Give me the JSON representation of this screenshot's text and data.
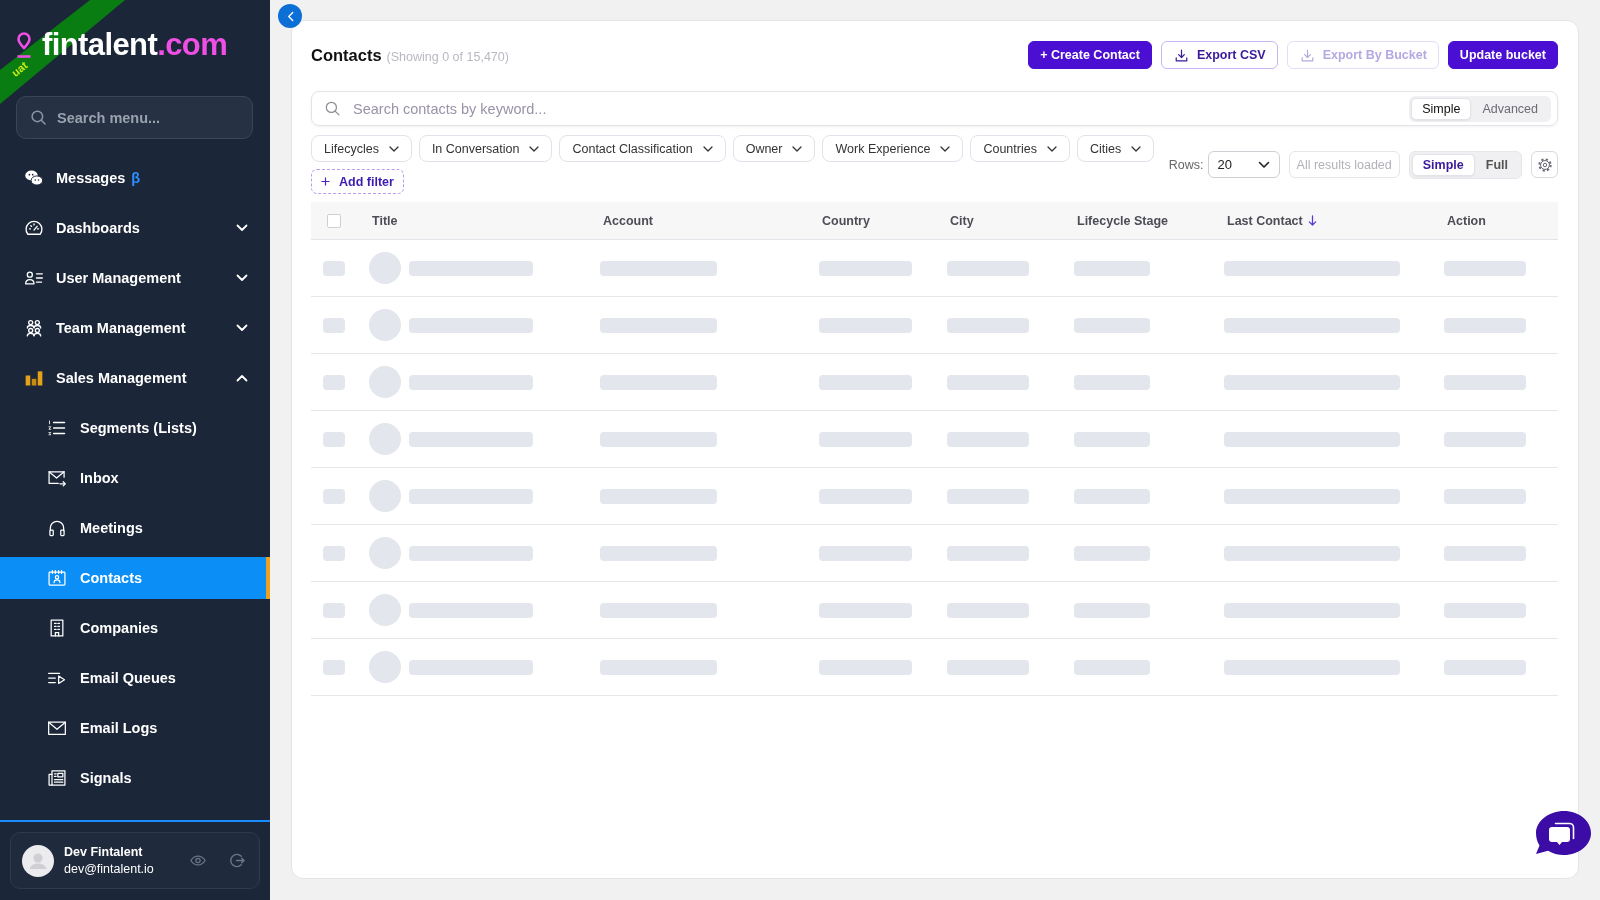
{
  "environment_ribbon": {
    "label": "uat"
  },
  "sidebar": {
    "logo": {
      "name": "fintalent",
      "domain": ".com"
    },
    "search": {
      "placeholder": "Search menu..."
    },
    "items": [
      {
        "label": "Messages",
        "badge": "β",
        "kind": "link",
        "selected": false
      },
      {
        "label": "Dashboards",
        "kind": "group",
        "expanded": false,
        "selected": false
      },
      {
        "label": "User Management",
        "kind": "group",
        "expanded": false,
        "selected": false
      },
      {
        "label": "Team Management",
        "kind": "group",
        "expanded": false,
        "selected": false
      },
      {
        "label": "Sales Management",
        "kind": "group",
        "expanded": true,
        "selected": false,
        "children": [
          {
            "label": "Segments (Lists)",
            "selected": false
          },
          {
            "label": "Inbox",
            "selected": false
          },
          {
            "label": "Meetings",
            "selected": false
          },
          {
            "label": "Contacts",
            "selected": true
          },
          {
            "label": "Companies",
            "selected": false
          },
          {
            "label": "Email Queues",
            "selected": false
          },
          {
            "label": "Email Logs",
            "selected": false
          },
          {
            "label": "Signals",
            "selected": false
          }
        ]
      }
    ],
    "user": {
      "name": "Dev Fintalent",
      "email": "dev@fintalent.io"
    }
  },
  "header": {
    "title": "Contacts",
    "count": "(Showing 0 of 15,470)",
    "buttons": [
      {
        "label": "+ Create Contact",
        "kind": "primary",
        "disabled": false
      },
      {
        "label": "Export CSV",
        "kind": "outline",
        "disabled": false
      },
      {
        "label": "Export By Bucket",
        "kind": "outline",
        "disabled": true
      },
      {
        "label": "Update bucket",
        "kind": "primary",
        "disabled": false
      }
    ]
  },
  "search": {
    "placeholder": "Search contacts by keyword...",
    "modes": [
      {
        "label": "Simple",
        "selected": true
      },
      {
        "label": "Advanced",
        "selected": false
      }
    ]
  },
  "filters": {
    "items": [
      {
        "label": "Lifecycles"
      },
      {
        "label": "In Conversation"
      },
      {
        "label": "Contact Classification"
      },
      {
        "label": "Owner"
      },
      {
        "label": "Work Experience"
      },
      {
        "label": "Countries"
      },
      {
        "label": "Cities"
      }
    ],
    "add_filter": {
      "label": "Add filter"
    }
  },
  "view_controls": {
    "rows_label": "Rows:",
    "rows_value": "20",
    "load_button": {
      "label": "All results loaded",
      "disabled": true
    },
    "modes": [
      {
        "label": "Simple",
        "selected": true
      },
      {
        "label": "Full",
        "selected": false
      }
    ]
  },
  "table": {
    "select_all": {
      "checked": false
    },
    "columns": [
      {
        "label": "Title",
        "sorted": false
      },
      {
        "label": "Account",
        "sorted": false
      },
      {
        "label": "Country",
        "sorted": false
      },
      {
        "label": "City",
        "sorted": false
      },
      {
        "label": "Lifecycle Stage",
        "sorted": false
      },
      {
        "label": "Last Contact",
        "sorted": true
      },
      {
        "label": "Action",
        "sorted": false
      }
    ],
    "rows": [
      {
        "kind": "skeleton"
      },
      {
        "kind": "skeleton"
      },
      {
        "kind": "skeleton"
      },
      {
        "kind": "skeleton"
      },
      {
        "kind": "skeleton"
      },
      {
        "kind": "skeleton"
      },
      {
        "kind": "skeleton"
      },
      {
        "kind": "skeleton"
      }
    ]
  }
}
